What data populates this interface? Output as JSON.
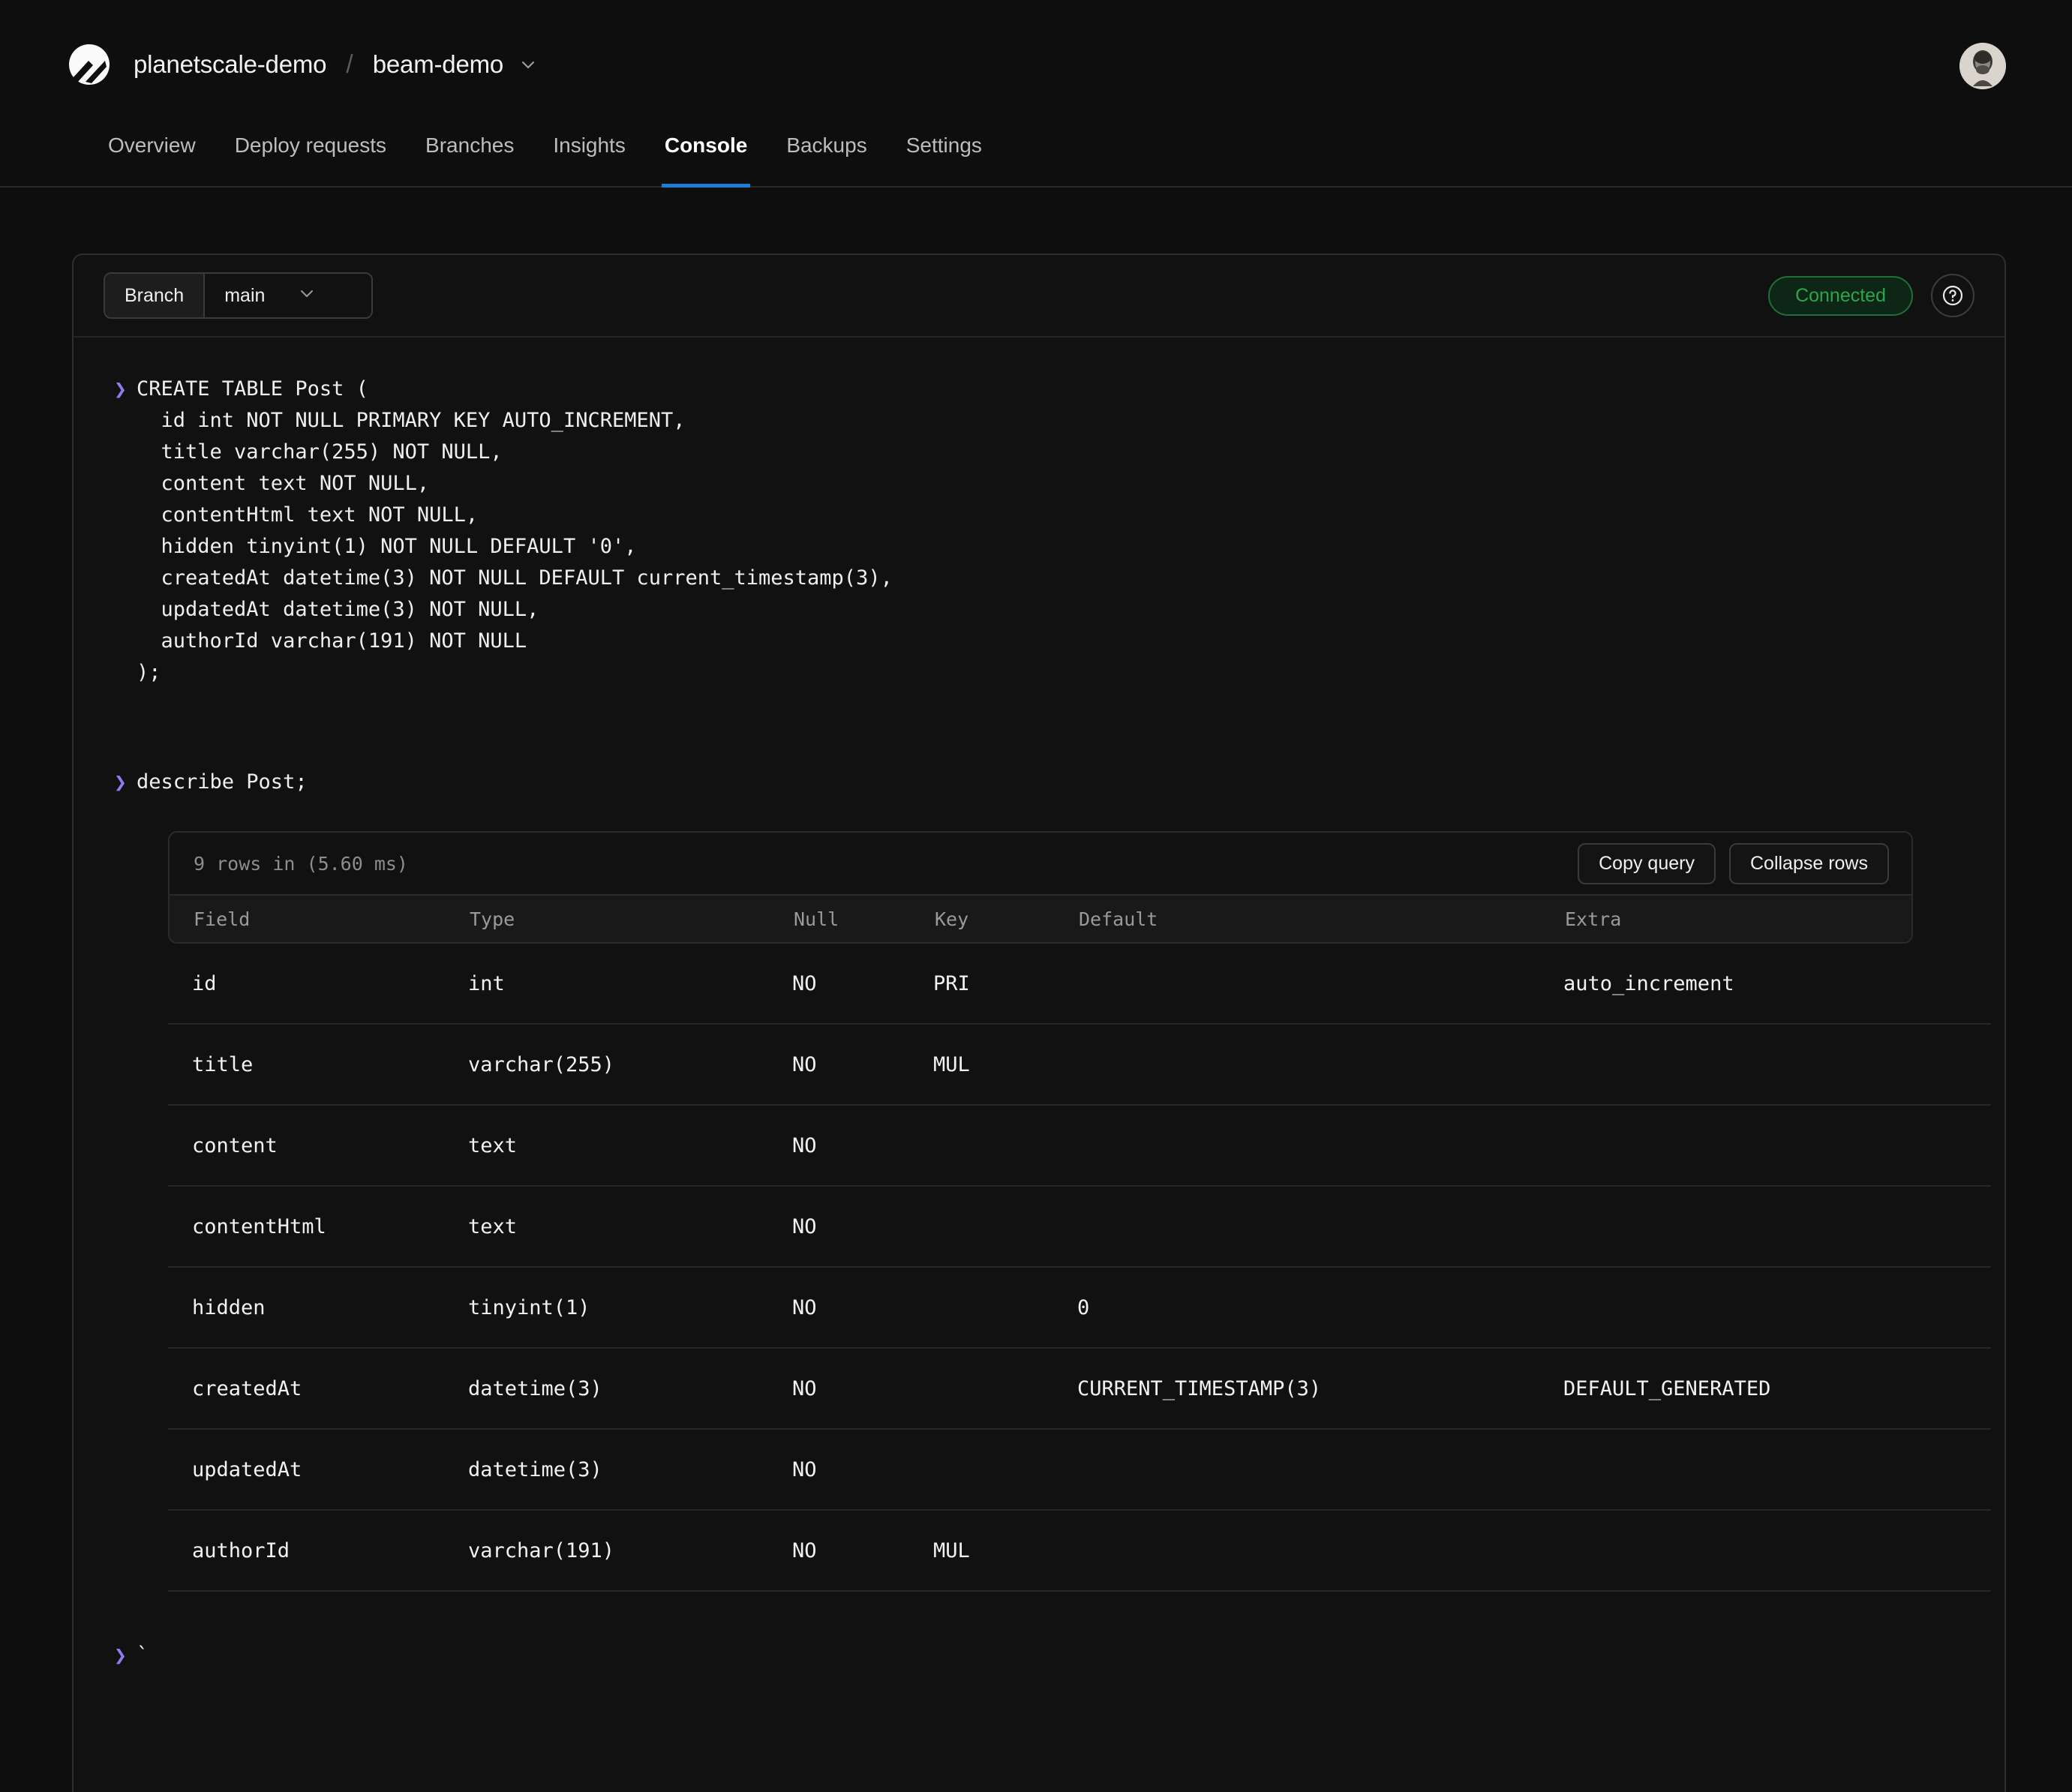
{
  "header": {
    "org": "planetscale-demo",
    "separator": "/",
    "database": "beam-demo",
    "logo_icon": "planetscale-logo-icon",
    "db_chevron_icon": "chevron-down-icon",
    "avatar_icon": "user-avatar",
    "tabs": [
      {
        "label": "Overview",
        "active": false
      },
      {
        "label": "Deploy requests",
        "active": false
      },
      {
        "label": "Branches",
        "active": false
      },
      {
        "label": "Insights",
        "active": false
      },
      {
        "label": "Console",
        "active": true
      },
      {
        "label": "Backups",
        "active": false
      },
      {
        "label": "Settings",
        "active": false
      }
    ],
    "active_tab_color": "#1a7fd4"
  },
  "console": {
    "branch_label": "Branch",
    "branch_value": "main",
    "branch_chevron_icon": "chevron-down-icon",
    "status_badge": "Connected",
    "status_color": "#2ea44f",
    "help_icon": "question-mark-icon",
    "prompt_symbol": "❯",
    "prompt_color": "#8d7df0"
  },
  "entries": [
    {
      "type": "query",
      "lines": [
        "CREATE TABLE Post (",
        "  id int NOT NULL PRIMARY KEY AUTO_INCREMENT,",
        "  title varchar(255) NOT NULL,",
        "  content text NOT NULL,",
        "  contentHtml text NOT NULL,",
        "  hidden tinyint(1) NOT NULL DEFAULT '0',",
        "  createdAt datetime(3) NOT NULL DEFAULT current_timestamp(3),",
        "  updatedAt datetime(3) NOT NULL,",
        "  authorId varchar(191) NOT NULL",
        ");"
      ]
    },
    {
      "type": "query",
      "lines": [
        "describe Post;"
      ]
    },
    {
      "type": "prompt",
      "lines": [
        "`"
      ]
    }
  ],
  "result": {
    "meta": "9 rows in (5.60 ms)",
    "copy_label": "Copy query",
    "collapse_label": "Collapse rows",
    "columns": [
      "Field",
      "Type",
      "Null",
      "Key",
      "Default",
      "Extra"
    ],
    "rows": [
      [
        "id",
        "int",
        "NO",
        "PRI",
        "",
        "auto_increment"
      ],
      [
        "title",
        "varchar(255)",
        "NO",
        "MUL",
        "",
        ""
      ],
      [
        "content",
        "text",
        "NO",
        "",
        "",
        ""
      ],
      [
        "contentHtml",
        "text",
        "NO",
        "",
        "",
        ""
      ],
      [
        "hidden",
        "tinyint(1)",
        "NO",
        "",
        "0",
        ""
      ],
      [
        "createdAt",
        "datetime(3)",
        "NO",
        "",
        "CURRENT_TIMESTAMP(3)",
        "DEFAULT_GENERATED"
      ],
      [
        "updatedAt",
        "datetime(3)",
        "NO",
        "",
        "",
        ""
      ],
      [
        "authorId",
        "varchar(191)",
        "NO",
        "MUL",
        "",
        ""
      ]
    ]
  }
}
